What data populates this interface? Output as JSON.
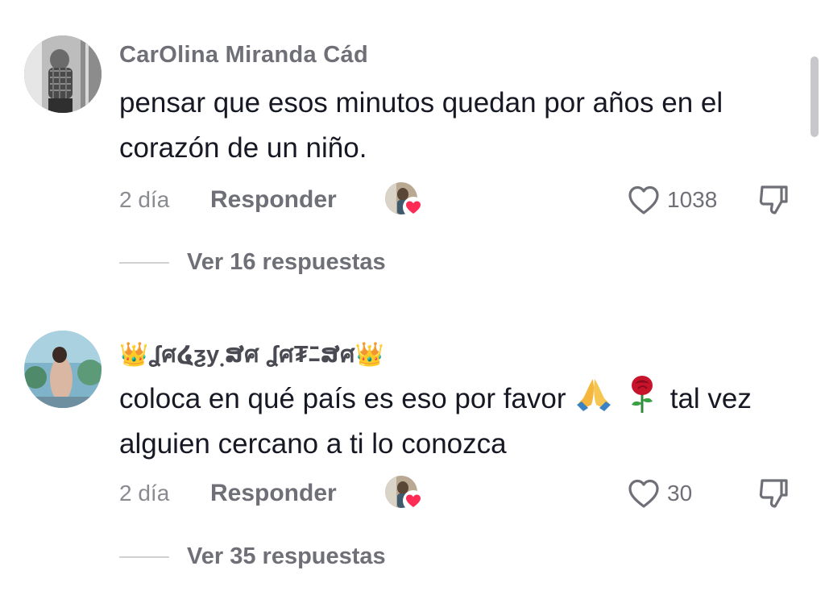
{
  "comments": [
    {
      "username": "CarOlina Miranda Cád",
      "text": "pensar que esos minutos quedan por años en el corazón de un niño.",
      "time": "2 día",
      "reply_label": "Responder",
      "like_count": "1038",
      "view_replies": "Ver 16 respuestas"
    },
    {
      "username": "👑ʆศ໔ƺy຺ສศ ʆศ₮ﾆສศ👑",
      "text_before": "coloca en qué país es eso por favor",
      "text_after": "tal vez alguien cercano a ti lo conozca",
      "emojis": [
        "praying-hands",
        "rose"
      ],
      "time": "2 día",
      "reply_label": "Responder",
      "like_count": "30",
      "view_replies": "Ver 35 respuestas"
    }
  ],
  "colors": {
    "primary_text": "#161823",
    "secondary_text": "#6f7077",
    "heart_red": "#fe2c55"
  }
}
